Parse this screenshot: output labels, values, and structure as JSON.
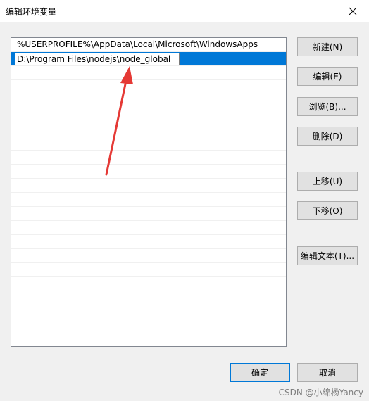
{
  "window": {
    "title": "编辑环境变量"
  },
  "list": {
    "items": [
      "%USERPROFILE%\\AppData\\Local\\Microsoft\\WindowsApps",
      "D:\\Program Files\\nodejs\\node_global"
    ],
    "selected_index": 1,
    "editing_value": "D:\\Program Files\\nodejs\\node_global"
  },
  "buttons": {
    "new": "新建(N)",
    "edit": "编辑(E)",
    "browse": "浏览(B)...",
    "delete": "删除(D)",
    "move_up": "上移(U)",
    "move_down": "下移(O)",
    "edit_text": "编辑文本(T)...",
    "ok": "确定",
    "cancel": "取消"
  },
  "watermark": "CSDN @小绵杨Yancy",
  "colors": {
    "selection": "#0078d7",
    "annotation_arrow": "#e53935"
  },
  "icons": {
    "close": "close-icon",
    "annotation": "red-arrow-icon"
  }
}
